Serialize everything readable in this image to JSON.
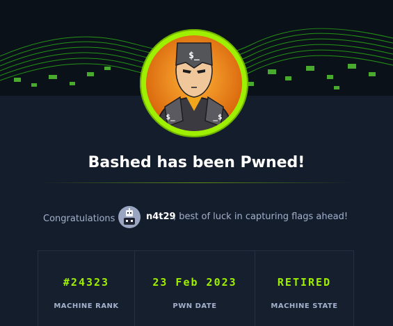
{
  "machine": {
    "title": "Bashed has been Pwned!"
  },
  "congrats": {
    "label": "Congratulations",
    "username": "n4t29",
    "message": ", best of luck in capturing flags ahead!"
  },
  "stats": [
    {
      "value": "#24323",
      "label": "MACHINE RANK"
    },
    {
      "value": "23 Feb 2023",
      "label": "PWN DATE"
    },
    {
      "value": "RETIRED",
      "label": "MACHINE STATE"
    }
  ],
  "colors": {
    "accent": "#9fef00",
    "background": "#141d2b",
    "muted_text": "#a4b1cd"
  },
  "icons": {
    "machine_avatar": "bash-hero-icon",
    "user_avatar": "robot-icon"
  }
}
